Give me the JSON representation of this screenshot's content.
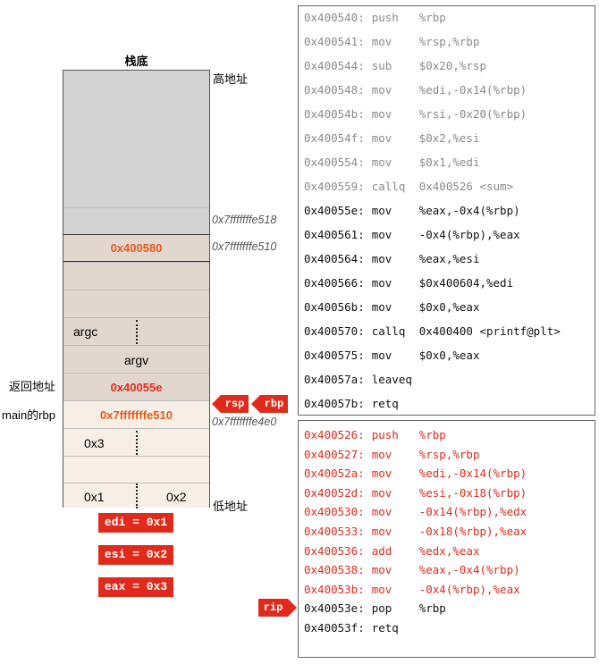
{
  "stack_title": "栈底",
  "label_high": "高地址",
  "label_low": "低地址",
  "label_ret": "返回地址",
  "label_main_rbp": "main的rbp",
  "addr_518": "0x7fffffffe518",
  "addr_510": "0x7fffffffe510",
  "addr_4e0": "0x7fffffffe4e0",
  "cells": {
    "ret_main": "0x400580",
    "argc": "argc",
    "argv": "argv",
    "ret_addr": "0x40055e",
    "saved_rbp": "0x7fffffffe510",
    "x3": "0x3",
    "x1": "0x1",
    "x2": "0x2"
  },
  "registers": [
    "edi = 0x1",
    "esi = 0x2",
    "eax = 0x3"
  ],
  "pointer_tags": {
    "rsp": "rsp",
    "rbp": "rbp",
    "rip": "rip"
  },
  "main_code": [
    {
      "addr": "0x400540:",
      "op": "push",
      "args": "%rbp",
      "style": "gray"
    },
    {
      "addr": "0x400541:",
      "op": "mov",
      "args": "%rsp,%rbp",
      "style": "gray"
    },
    {
      "addr": "0x400544:",
      "op": "sub",
      "args": "$0x20,%rsp",
      "style": "gray"
    },
    {
      "addr": "0x400548:",
      "op": "mov",
      "args": "%edi,-0x14(%rbp)",
      "style": "gray"
    },
    {
      "addr": "0x40054b:",
      "op": "mov",
      "args": "%rsi,-0x20(%rbp)",
      "style": "gray"
    },
    {
      "addr": "0x40054f:",
      "op": "mov",
      "args": "$0x2,%esi",
      "style": "gray"
    },
    {
      "addr": "0x400554:",
      "op": "mov",
      "args": "$0x1,%edi",
      "style": "gray"
    },
    {
      "addr": "0x400559:",
      "op": "callq",
      "args": "0x400526 <sum>",
      "style": "gray"
    },
    {
      "addr": "0x40055e:",
      "op": "mov",
      "args": "%eax,-0x4(%rbp)",
      "style": "black"
    },
    {
      "addr": "0x400561:",
      "op": "mov",
      "args": "-0x4(%rbp),%eax",
      "style": "black"
    },
    {
      "addr": "0x400564:",
      "op": "mov",
      "args": "%eax,%esi",
      "style": "black"
    },
    {
      "addr": "0x400566:",
      "op": "mov",
      "args": "$0x400604,%edi",
      "style": "black"
    },
    {
      "addr": "0x40056b:",
      "op": "mov",
      "args": "$0x0,%eax",
      "style": "black"
    },
    {
      "addr": "0x400570:",
      "op": "callq",
      "args": "0x400400 <printf@plt>",
      "style": "black"
    },
    {
      "addr": "0x400575:",
      "op": "mov",
      "args": "$0x0,%eax",
      "style": "black"
    },
    {
      "addr": "0x40057a:",
      "op": "leaveq",
      "args": "",
      "style": "black"
    },
    {
      "addr": "0x40057b:",
      "op": "retq",
      "args": "",
      "style": "black"
    }
  ],
  "sum_code": [
    {
      "addr": "0x400526:",
      "op": "push",
      "args": "%rbp",
      "style": "red"
    },
    {
      "addr": "0x400527:",
      "op": "mov",
      "args": "%rsp,%rbp",
      "style": "red"
    },
    {
      "addr": "0x40052a:",
      "op": "mov",
      "args": "%edi,-0x14(%rbp)",
      "style": "red"
    },
    {
      "addr": "0x40052d:",
      "op": "mov",
      "args": "%esi,-0x18(%rbp)",
      "style": "red"
    },
    {
      "addr": "0x400530:",
      "op": "mov",
      "args": "-0x14(%rbp),%edx",
      "style": "red"
    },
    {
      "addr": "0x400533:",
      "op": "mov",
      "args": "-0x18(%rbp),%eax",
      "style": "red"
    },
    {
      "addr": "0x400536:",
      "op": "add",
      "args": "%edx,%eax",
      "style": "red"
    },
    {
      "addr": "0x400538:",
      "op": "mov",
      "args": "%eax,-0x4(%rbp)",
      "style": "red"
    },
    {
      "addr": "0x40053b:",
      "op": "mov",
      "args": "-0x4(%rbp),%eax",
      "style": "red"
    },
    {
      "addr": "0x40053e:",
      "op": "pop",
      "args": "%rbp",
      "style": "black"
    },
    {
      "addr": "0x40053f:",
      "op": "retq",
      "args": "",
      "style": "black"
    }
  ]
}
